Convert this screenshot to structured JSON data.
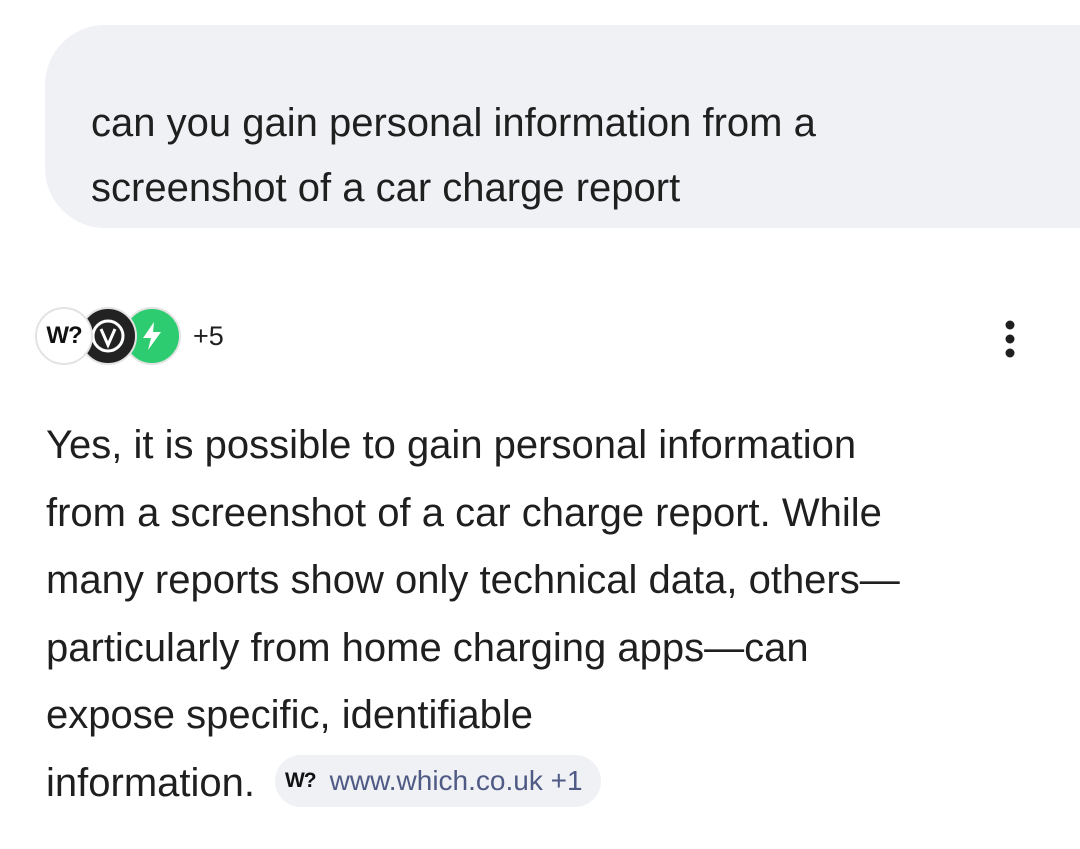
{
  "user_message": {
    "lines": [
      "can you gain personal information from a",
      "screenshot of a car charge report"
    ]
  },
  "sources": {
    "icons": [
      "which-logo-icon",
      "vt-logo-icon",
      "bolt-logo-icon"
    ],
    "which_logo_text": "W?",
    "more_count": "+5"
  },
  "menu": {
    "icon": "more-vert-icon"
  },
  "answer": {
    "lines": [
      "Yes, it is possible to gain personal information",
      "from a screenshot of a car charge report. While",
      "many reports show only technical data, others—",
      "particularly from home charging apps—can",
      "expose specific, identifiable",
      "information."
    ],
    "citation": {
      "logo_text": "W?",
      "label": "www.which.co.uk +1"
    }
  },
  "colors": {
    "bubble_bg": "#eff1f5",
    "chip_text": "#4f5a85",
    "bolt_green": "#2ecc71"
  }
}
